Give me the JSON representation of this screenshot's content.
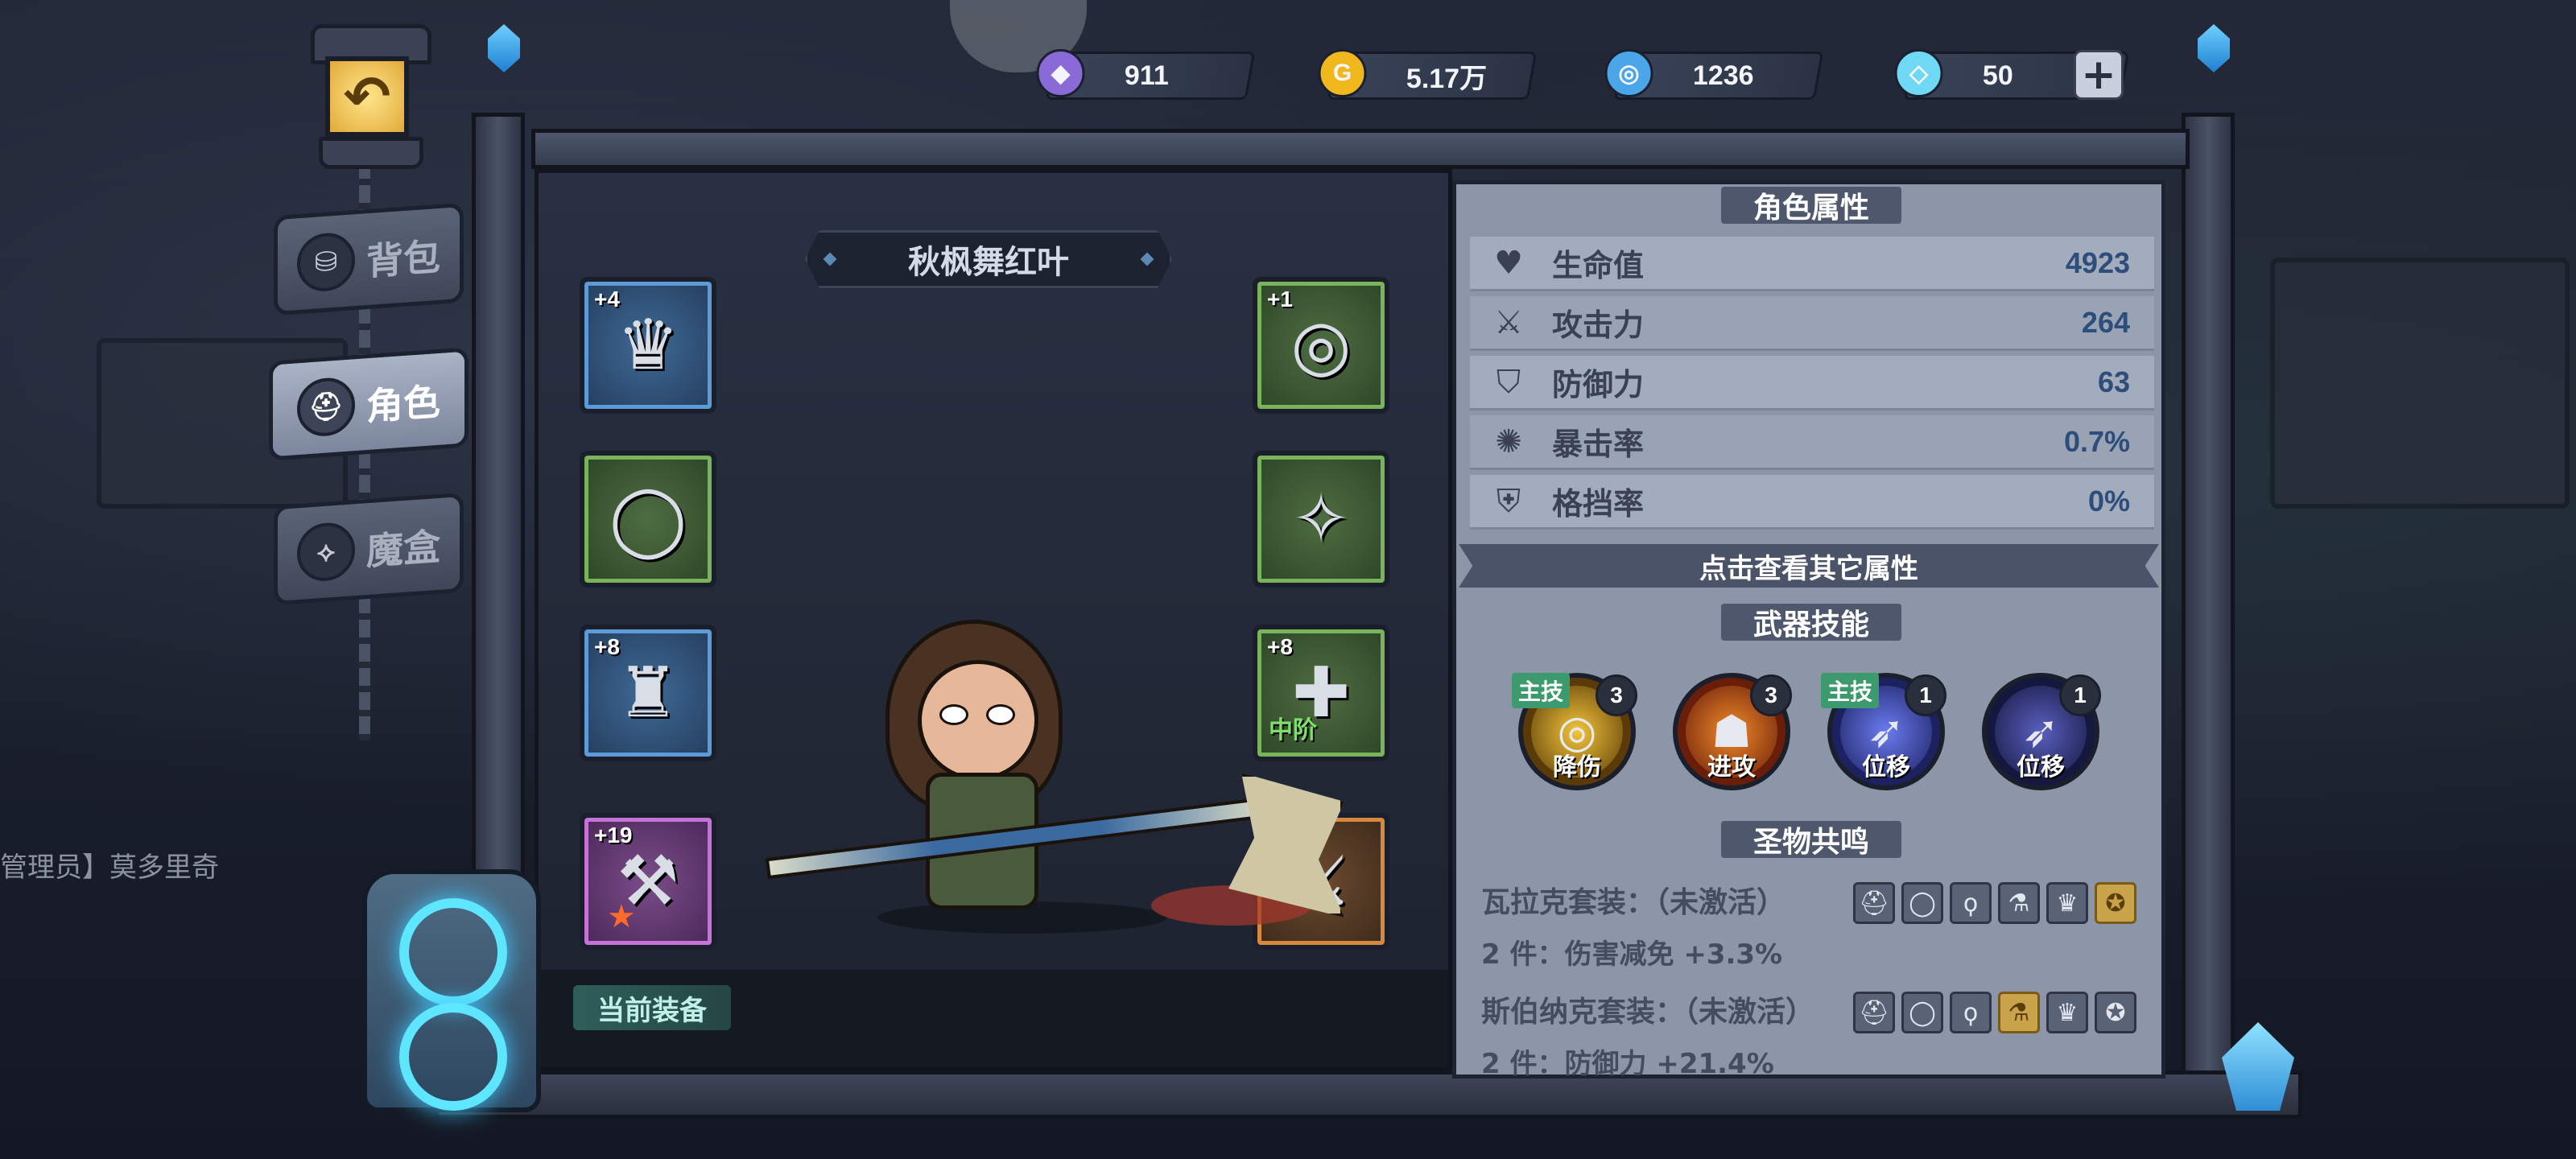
{
  "resources": [
    {
      "name": "purple-token",
      "icon": "purple-token-icon",
      "value": "911",
      "color": "#8a6ad6"
    },
    {
      "name": "gold-coin",
      "icon": "gold-coin-icon",
      "value": "5.17万",
      "color": "#f1b81d"
    },
    {
      "name": "blue-orb",
      "icon": "blue-orb-icon",
      "value": "1236",
      "color": "#4aa6e8"
    },
    {
      "name": "diamond",
      "icon": "diamond-icon",
      "value": "50",
      "color": "#6fd9f5"
    }
  ],
  "nav": {
    "back_icon": "back-arrow-icon",
    "items": [
      {
        "label": "背包",
        "icon": "backpack-icon",
        "active": false
      },
      {
        "label": "角色",
        "icon": "helmet-icon",
        "active": true
      },
      {
        "label": "魔盒",
        "icon": "magic-box-icon",
        "active": false
      }
    ]
  },
  "background": {
    "npc_label": "管理员】莫多里奇"
  },
  "character": {
    "name": "秋枫舞红叶"
  },
  "equipment": {
    "left": [
      {
        "slot": "tiara",
        "icon": "tiara-icon",
        "level": "+4",
        "rarity": "blue",
        "glyph": "♛"
      },
      {
        "slot": "necklace",
        "icon": "necklace-icon",
        "level": "",
        "rarity": "green",
        "glyph": "◯"
      },
      {
        "slot": "chalice",
        "icon": "chalice-icon",
        "level": "+8",
        "rarity": "blue",
        "glyph": "♜"
      },
      {
        "slot": "weapon",
        "icon": "axe-icon",
        "level": "+19",
        "rarity": "purple",
        "glyph": "⚒"
      }
    ],
    "right": [
      {
        "slot": "ring",
        "icon": "ring-icon",
        "level": "+1",
        "rarity": "green",
        "glyph": "◎"
      },
      {
        "slot": "earrings",
        "icon": "earrings-icon",
        "level": "",
        "rarity": "green",
        "glyph": "✧"
      },
      {
        "slot": "doll",
        "icon": "doll-icon",
        "level": "+8",
        "rarity": "green",
        "glyph": "✚",
        "tier": "中阶"
      },
      {
        "slot": "dual-blades",
        "icon": "crossed-blades-icon",
        "level": "",
        "rarity": "orange",
        "glyph": "⚔"
      }
    ],
    "current_label": "当前装备"
  },
  "attributes": {
    "title": "角色属性",
    "rows": [
      {
        "icon": "heart-icon",
        "glyph": "♥",
        "label": "生命值",
        "value": "4923"
      },
      {
        "icon": "sword-icon",
        "glyph": "⚔",
        "label": "攻击力",
        "value": "264"
      },
      {
        "icon": "shield-icon",
        "glyph": "⛉",
        "label": "防御力",
        "value": "63"
      },
      {
        "icon": "crit-icon",
        "glyph": "✺",
        "label": "暴击率",
        "value": "0.7%"
      },
      {
        "icon": "block-icon",
        "glyph": "⛨",
        "label": "格挡率",
        "value": "0%"
      }
    ],
    "more_button": "点击查看其它属性"
  },
  "skills": {
    "title": "武器技能",
    "items": [
      {
        "badge": "主技",
        "count": "3",
        "name": "降伤",
        "icon": "damage-reduction-icon",
        "color1": "#f3c43a",
        "color2": "#5a3a08"
      },
      {
        "badge": "",
        "count": "3",
        "name": "进攻",
        "icon": "attack-icon",
        "color1": "#f08a2a",
        "color2": "#6a1e0a"
      },
      {
        "badge": "主技",
        "count": "1",
        "name": "位移",
        "icon": "dash-icon",
        "color1": "#6a7cf0",
        "color2": "#1c2160"
      },
      {
        "badge": "",
        "count": "1",
        "name": "位移",
        "icon": "dash-icon",
        "color1": "#5a5fc0",
        "color2": "#15183e"
      }
    ]
  },
  "relics": {
    "title": "圣物共鸣",
    "sets": [
      {
        "name": "瓦拉克套装：（未激活）",
        "bonus": "2 件：伤害减免 +3.3%",
        "icons": [
          {
            "icon": "helmet-relic-icon",
            "glyph": "⛑",
            "on": false
          },
          {
            "icon": "ring-relic-icon",
            "glyph": "◯",
            "on": false
          },
          {
            "icon": "necklace-relic-icon",
            "glyph": "ϙ",
            "on": false
          },
          {
            "icon": "flask-relic-icon",
            "glyph": "⚗",
            "on": false
          },
          {
            "icon": "trophy-relic-icon",
            "glyph": "♛",
            "on": false
          },
          {
            "icon": "medal-relic-icon",
            "glyph": "✪",
            "on": true
          }
        ]
      },
      {
        "name": "斯伯纳克套装：（未激活）",
        "bonus": "2 件：防御力 +21.4%",
        "icons": [
          {
            "icon": "helmet-relic-icon",
            "glyph": "⛑",
            "on": false
          },
          {
            "icon": "ring-relic-icon",
            "glyph": "◯",
            "on": false
          },
          {
            "icon": "necklace-relic-icon",
            "glyph": "ϙ",
            "on": false
          },
          {
            "icon": "flask-relic-icon",
            "glyph": "⚗",
            "on": true
          },
          {
            "icon": "trophy-relic-icon",
            "glyph": "♛",
            "on": false
          },
          {
            "icon": "medal-relic-icon",
            "glyph": "✪",
            "on": false
          }
        ]
      }
    ]
  }
}
